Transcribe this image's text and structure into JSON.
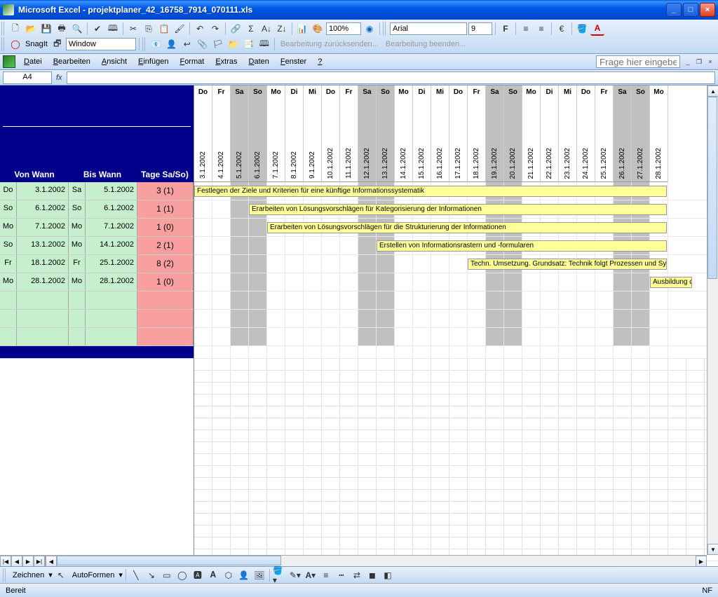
{
  "app": {
    "title": "Microsoft Excel - projektplaner_42_16758_7914_070111.xls"
  },
  "window_buttons": {
    "min": "_",
    "max": "□",
    "close": "×"
  },
  "toolbar2": {
    "snagit": "SnagIt",
    "window_label": "Window",
    "font_name": "Arial",
    "font_size": "9",
    "zoom": "100%",
    "bearbeit_zuruck": "Bearbeitung zurücksenden...",
    "bearbeit_beenden": "Bearbeitung beenden..."
  },
  "menubar": [
    "Datei",
    "Bearbeiten",
    "Ansicht",
    "Einfügen",
    "Format",
    "Extras",
    "Daten",
    "Fenster",
    "?"
  ],
  "helpbox_placeholder": "Frage hier eingeben",
  "formula": {
    "name_box": "A4",
    "fx": "fx"
  },
  "headers": {
    "von": "Von Wann",
    "bis": "Bis Wann",
    "tage": "Tage Sa/So)"
  },
  "days": [
    {
      "name": "Do",
      "date": "3.1.2002",
      "wknd": false
    },
    {
      "name": "Fr",
      "date": "4.1.2002",
      "wknd": false
    },
    {
      "name": "Sa",
      "date": "5.1.2002",
      "wknd": true
    },
    {
      "name": "So",
      "date": "6.1.2002",
      "wknd": true
    },
    {
      "name": "Mo",
      "date": "7.1.2002",
      "wknd": false
    },
    {
      "name": "Di",
      "date": "8.1.2002",
      "wknd": false
    },
    {
      "name": "Mi",
      "date": "9.1.2002",
      "wknd": false
    },
    {
      "name": "Do",
      "date": "10.1.2002",
      "wknd": false
    },
    {
      "name": "Fr",
      "date": "11.1.2002",
      "wknd": false
    },
    {
      "name": "Sa",
      "date": "12.1.2002",
      "wknd": true
    },
    {
      "name": "So",
      "date": "13.1.2002",
      "wknd": true
    },
    {
      "name": "Mo",
      "date": "14.1.2002",
      "wknd": false
    },
    {
      "name": "Di",
      "date": "15.1.2002",
      "wknd": false
    },
    {
      "name": "Mi",
      "date": "16.1.2002",
      "wknd": false
    },
    {
      "name": "Do",
      "date": "17.1.2002",
      "wknd": false
    },
    {
      "name": "Fr",
      "date": "18.1.2002",
      "wknd": false
    },
    {
      "name": "Sa",
      "date": "19.1.2002",
      "wknd": true
    },
    {
      "name": "So",
      "date": "20.1.2002",
      "wknd": true
    },
    {
      "name": "Mo",
      "date": "21.1.2002",
      "wknd": false
    },
    {
      "name": "Di",
      "date": "22.1.2002",
      "wknd": false
    },
    {
      "name": "Mi",
      "date": "23.1.2002",
      "wknd": false
    },
    {
      "name": "Do",
      "date": "24.1.2002",
      "wknd": false
    },
    {
      "name": "Fr",
      "date": "25.1.2002",
      "wknd": false
    },
    {
      "name": "Sa",
      "date": "26.1.2002",
      "wknd": true
    },
    {
      "name": "So",
      "date": "27.1.2002",
      "wknd": true
    },
    {
      "name": "Mo",
      "date": "28.1.2002",
      "wknd": false
    }
  ],
  "tasks": [
    {
      "von_day": "Do",
      "von_date": "3.1.2002",
      "bis_day": "Sa",
      "bis_date": "5.1.2002",
      "tage": "3 (1)",
      "start": 0,
      "text": "Festlegen der Ziele und Kriterien für eine künftige Informationssystematik"
    },
    {
      "von_day": "So",
      "von_date": "6.1.2002",
      "bis_day": "So",
      "bis_date": "6.1.2002",
      "tage": "1 (1)",
      "start": 3,
      "text": "Erarbeiten von Lösungsvorschlägen für Kategorisierung der Informationen"
    },
    {
      "von_day": "Mo",
      "von_date": "7.1.2002",
      "bis_day": "Mo",
      "bis_date": "7.1.2002",
      "tage": "1 (0)",
      "start": 4,
      "text": "Erarbeiten von Lösungsvorschlägen für die Strukturierung der Informationen"
    },
    {
      "von_day": "So",
      "von_date": "13.1.2002",
      "bis_day": "Mo",
      "bis_date": "14.1.2002",
      "tage": "2 (1)",
      "start": 10,
      "text": "Erstellen von Informationsrastern und -formularen"
    },
    {
      "von_day": "Fr",
      "von_date": "18.1.2002",
      "bis_day": "Fr",
      "bis_date": "25.1.2002",
      "tage": "8 (2)",
      "start": 15,
      "text": "Techn. Umsetzung. Grundsatz: Technik folgt Prozessen und Systemen, verein"
    },
    {
      "von_day": "Mo",
      "von_date": "28.1.2002",
      "bis_day": "Mo",
      "bis_date": "28.1.2002",
      "tage": "1 (0)",
      "start": 25,
      "text": "Ausbildung der Anwend"
    }
  ],
  "drawbar": {
    "zeichnen": "Zeichnen",
    "autoformen": "AutoFormen"
  },
  "status": {
    "ready": "Bereit",
    "nf": "NF"
  }
}
